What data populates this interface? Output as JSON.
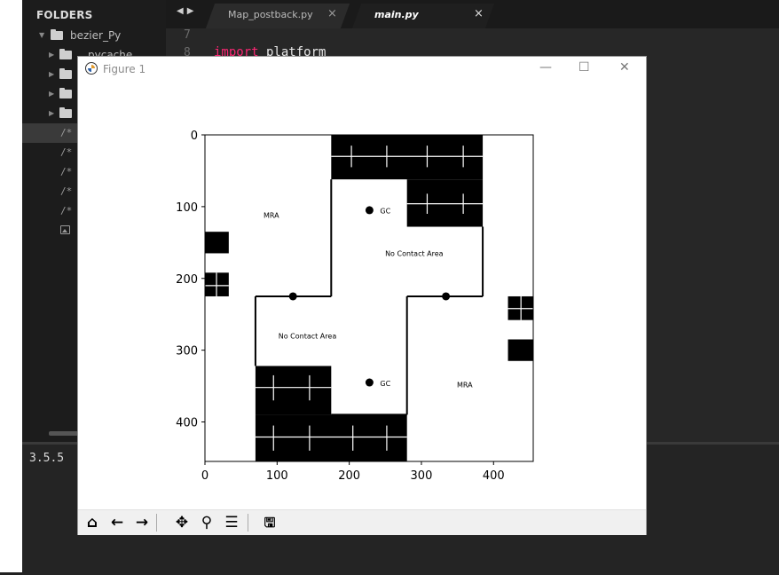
{
  "sidebar": {
    "header": "FOLDERS",
    "root_folder": "bezier_Py",
    "items": [
      {
        "kind": "folder",
        "label": "pycache"
      },
      {
        "kind": "folder",
        "label": ""
      },
      {
        "kind": "folder",
        "label": ""
      },
      {
        "kind": "folder",
        "label": ""
      },
      {
        "kind": "comment",
        "label": "/*"
      },
      {
        "kind": "comment",
        "label": "/*"
      },
      {
        "kind": "comment",
        "label": "/*"
      },
      {
        "kind": "comment",
        "label": "/*"
      },
      {
        "kind": "comment",
        "label": "/*"
      },
      {
        "kind": "image",
        "label": ""
      }
    ]
  },
  "tabs": [
    {
      "label": "Map_postback.py",
      "close": "×"
    },
    {
      "label": "main.py",
      "close": "×"
    }
  ],
  "editor": {
    "line7": "7",
    "line8": "8",
    "code_kw": "import",
    "code_rest": " platform"
  },
  "console": {
    "text": "3.5.5"
  },
  "figure": {
    "title": "Figure 1",
    "minimize": "—",
    "maximize": "☐",
    "close": "✕"
  },
  "chart_data": {
    "type": "image",
    "x_ticks": [
      0,
      100,
      200,
      300,
      400
    ],
    "y_ticks": [
      0,
      100,
      200,
      300,
      400
    ],
    "xlim": [
      0,
      455
    ],
    "ylim": [
      455,
      0
    ],
    "labels": [
      {
        "text": "MRA",
        "x": 92,
        "y": 112
      },
      {
        "text": "GC",
        "x": 250,
        "y": 106
      },
      {
        "text": "No Contact Area",
        "x": 290,
        "y": 165
      },
      {
        "text": "No Contact Area",
        "x": 142,
        "y": 280
      },
      {
        "text": "GC",
        "x": 250,
        "y": 346
      },
      {
        "text": "MRA",
        "x": 360,
        "y": 348
      }
    ],
    "points": [
      {
        "x": 228,
        "y": 105
      },
      {
        "x": 122,
        "y": 225
      },
      {
        "x": 334,
        "y": 225
      },
      {
        "x": 228,
        "y": 345
      }
    ]
  }
}
